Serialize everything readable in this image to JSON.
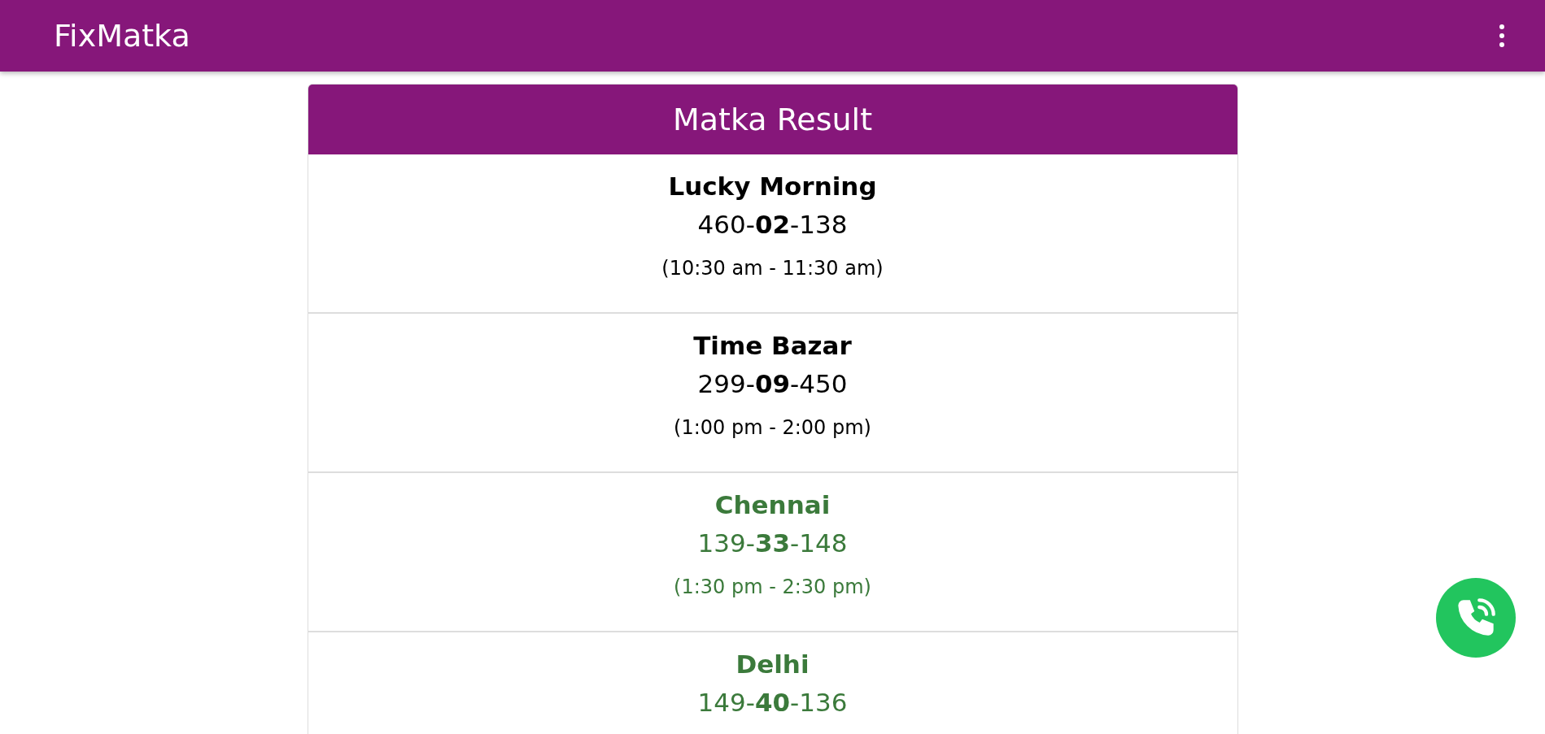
{
  "app_bar": {
    "title": "FixMatka"
  },
  "card": {
    "title": "Matka Result",
    "markets": [
      {
        "name": "Lucky Morning",
        "result": "460-**02**-138",
        "time": "(10:30 am - 11:30 am)",
        "color": "#000000"
      },
      {
        "name": "Time Bazar",
        "result": "299-**09**-450",
        "time": "(1:00 pm - 2:00 pm)",
        "color": "#000000"
      },
      {
        "name": "Chennai",
        "result": "139-**33**-148",
        "time": "(1:30 pm - 2:30 pm)",
        "color": "#3b7a3b"
      },
      {
        "name": "Delhi",
        "result": "149-**40**-136",
        "color": "#3b7a3b"
      }
    ]
  }
}
